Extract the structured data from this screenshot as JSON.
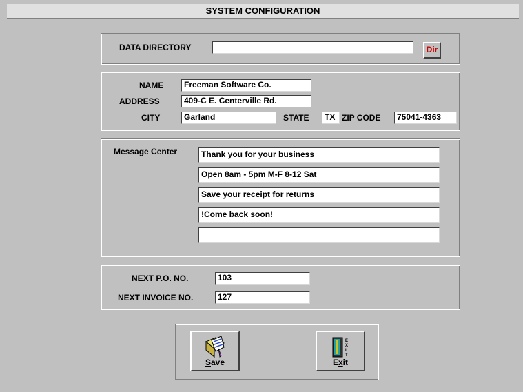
{
  "title": "SYSTEM CONFIGURATION",
  "data_directory": {
    "label": "DATA DIRECTORY",
    "value": "",
    "button_label": "Dir"
  },
  "company": {
    "name_label": "NAME",
    "name_value": "Freeman Software Co.",
    "address_label": "ADDRESS",
    "address_value": "409-C E. Centerville Rd.",
    "city_label": "CITY",
    "city_value": "Garland",
    "state_label": "STATE",
    "state_value": "TX",
    "zip_label": "ZIP CODE",
    "zip_value": "75041-4363"
  },
  "message_center": {
    "label": "Message Center",
    "lines": [
      "Thank you for your business",
      "Open 8am - 5pm M-F  8-12 Sat",
      "Save your receipt for returns",
      "!Come back soon!",
      ""
    ]
  },
  "numbers": {
    "po_label": "NEXT P.O. NO.",
    "po_value": "103",
    "invoice_label": "NEXT INVOICE NO.",
    "invoice_value": "127"
  },
  "buttons": {
    "save_prefix": "",
    "save_ul": "S",
    "save_rest": "ave",
    "exit_prefix": "E",
    "exit_ul": "x",
    "exit_rest": "it",
    "save_icon": "save-icon",
    "exit_icon": "exit-door-icon"
  },
  "colors": {
    "background": "#c0c0c0",
    "dir_button_text": "#cc0000"
  }
}
